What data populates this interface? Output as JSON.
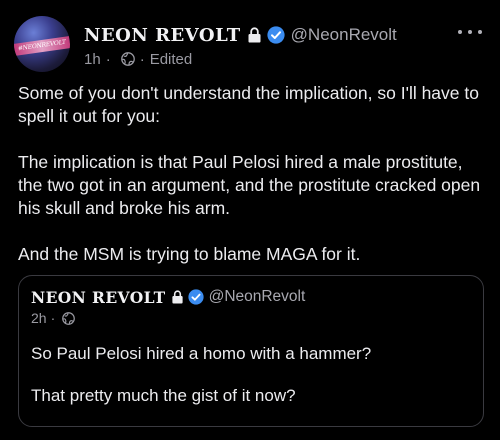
{
  "post": {
    "author": {
      "display_name": "NEON REVOLT",
      "handle": "@NeonRevolt",
      "avatar_text": "#NEONREVOLT",
      "avatar_icon": "avatar-image",
      "lock_icon": "lock-icon",
      "verified_icon": "verified-badge-icon"
    },
    "meta": {
      "time": "1h",
      "separator": "·",
      "visibility_icon": "globe-icon",
      "edited": "Edited"
    },
    "more_icon": "more-options-icon",
    "body": [
      "Some of you don't understand the implication, so I'll have to spell it out for you:",
      "The implication is that Paul Pelosi hired a male prostitute, the two got in an argument, and the prostitute cracked open his skull and broke his arm.",
      "And the MSM is trying to blame MAGA for it."
    ]
  },
  "quoted_post": {
    "author": {
      "display_name": "NEON REVOLT",
      "handle": "@NeonRevolt"
    },
    "meta": {
      "time": "2h",
      "separator": "·"
    },
    "body": [
      "So Paul Pelosi hired a homo with a hammer?",
      "That pretty much the gist of it now?"
    ]
  },
  "colors": {
    "background": "#000000",
    "text": "#ececef",
    "secondary_text": "#a8a8b0",
    "verified_blue": "#3b8cf0",
    "quote_border": "#3a3a40"
  }
}
